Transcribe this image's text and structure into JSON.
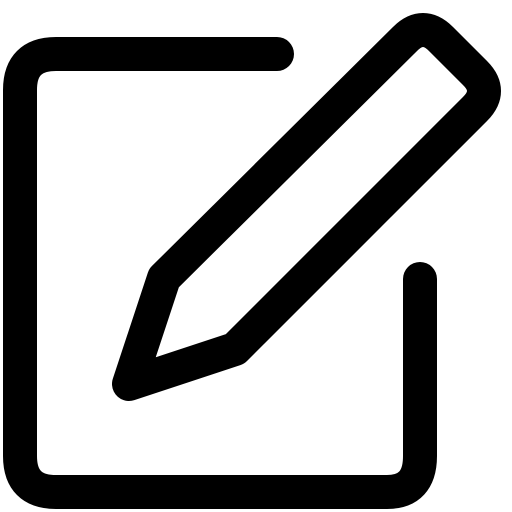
{
  "icon": {
    "name": "edit-icon",
    "parts": [
      "document-frame",
      "pencil"
    ]
  },
  "colors": {
    "background": "#ffffff",
    "stroke": "#000000"
  }
}
